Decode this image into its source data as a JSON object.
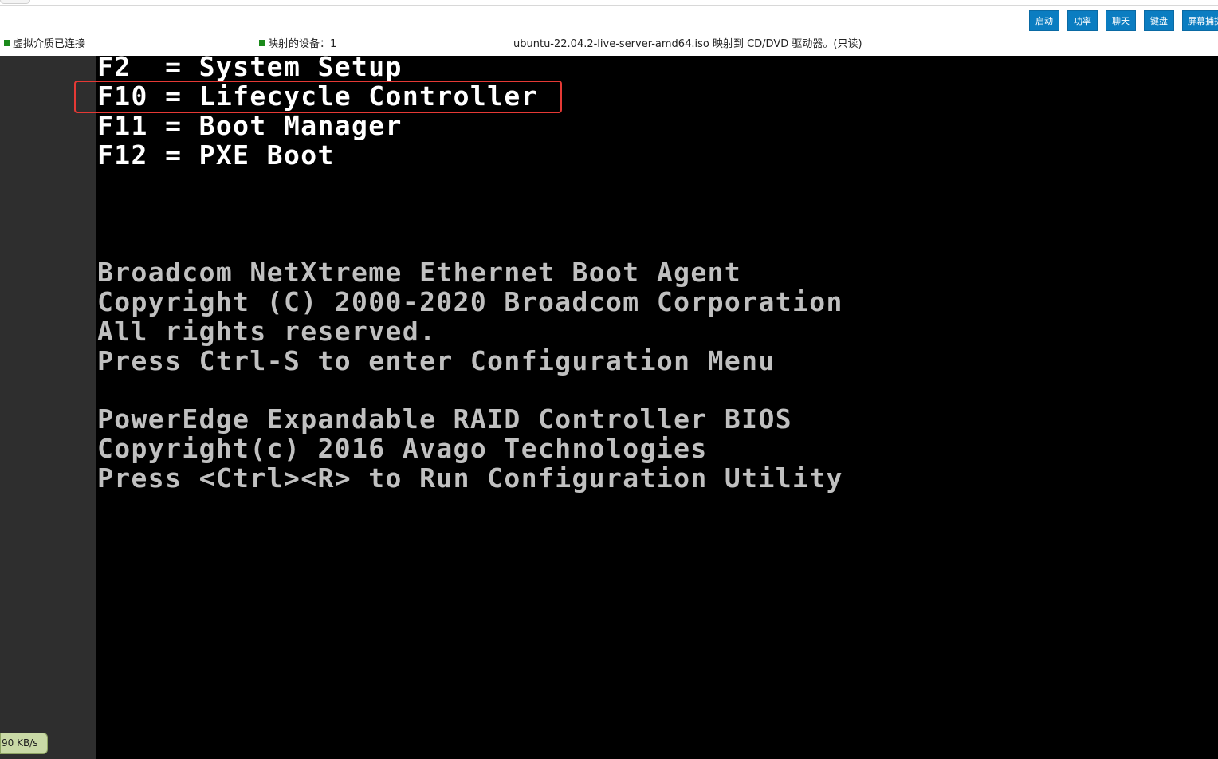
{
  "toolbar": {
    "buttons": [
      {
        "label": "启动"
      },
      {
        "label": "功率"
      },
      {
        "label": "聊天"
      },
      {
        "label": "键盘"
      },
      {
        "label": "屏幕捕捉"
      }
    ],
    "button_color": "#0b7dc1"
  },
  "status": {
    "media": "虚拟介质已连接",
    "mapped_devices": "映射的设备：1",
    "mapping_info": "ubuntu-22.04.2-live-server-amd64.iso 映射到 CD/DVD 驱动器。(只读)",
    "indicator_color": "#1b8a1b"
  },
  "console": {
    "lines": [
      "F2  = System Setup",
      "F10 = Lifecycle Controller",
      "F11 = Boot Manager",
      "F12 = PXE Boot",
      "Broadcom NetXtreme Ethernet Boot Agent",
      "Copyright (C) 2000-2020 Broadcom Corporation",
      "All rights reserved.",
      "Press Ctrl-S to enter Configuration Menu",
      "PowerEdge Expandable RAID Controller BIOS",
      "Copyright(c) 2016 Avago Technologies",
      "Press <Ctrl><R> to Run Configuration Utility"
    ],
    "highlight_color": "#e53935"
  },
  "speed_badge": "90 KB/s"
}
